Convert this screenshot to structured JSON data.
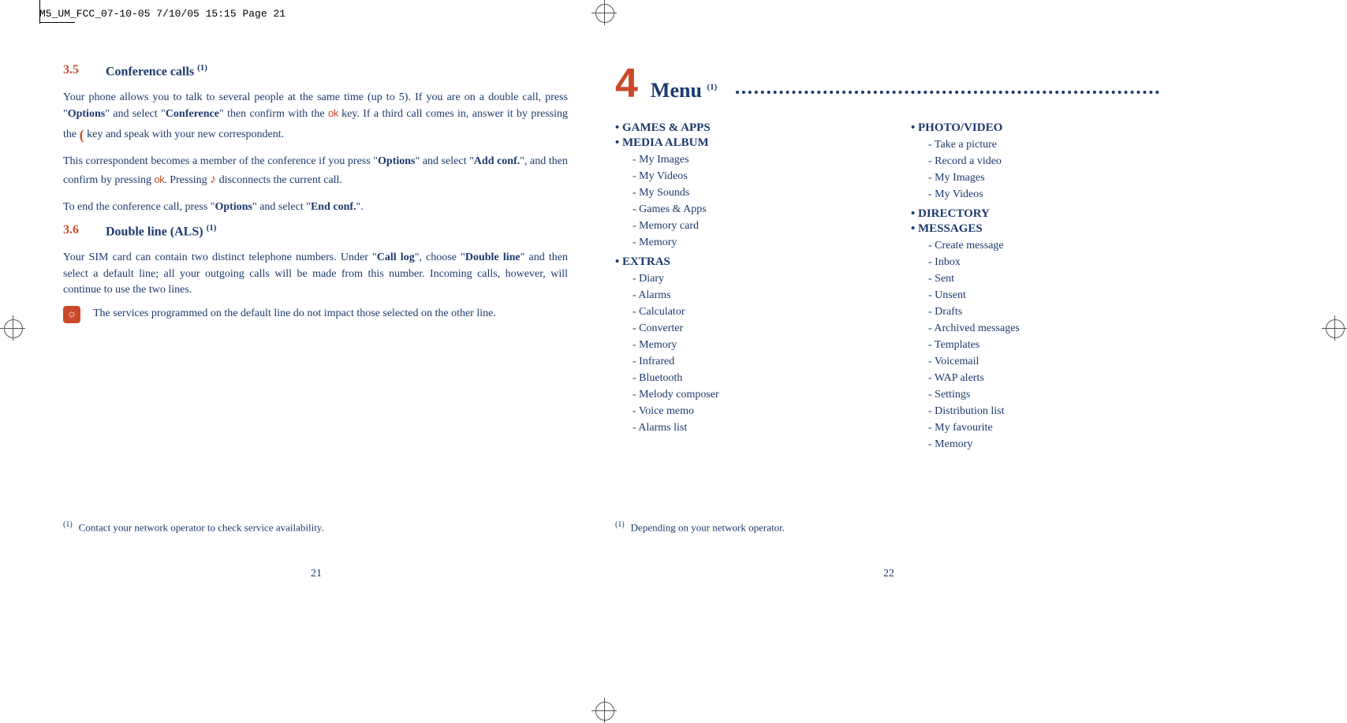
{
  "print_header": "M5_UM_FCC_07-10-05  7/10/05  15:15  Page 21",
  "left": {
    "sec35": {
      "num": "3.5",
      "title": "Conference calls ",
      "sup": "(1)"
    },
    "p35a_pre": "Your phone allows you to talk to several people at the same time (up to 5). If you are on a double call, press \"",
    "p35a_bold1": "Options",
    "p35a_mid1": "\" and select \"",
    "p35a_bold2": "Conference",
    "p35a_mid2": "\" then confirm with the ",
    "ok_label": "ok",
    "p35a_mid3": " key. If a third call comes in, answer it by pressing the ",
    "call_key_glyph": "(",
    "p35a_end": " key and speak with your new correspondent.",
    "p35b_pre": "This correspondent becomes a member of the conference if you press \"",
    "p35b_bold1": "Options",
    "p35b_mid1": "\" and select \"",
    "p35b_bold2": "Add conf.",
    "p35b_mid2": "\", and then confirm by pressing ",
    "p35b_mid3": ". Pressing ",
    "hangup_glyph": "♪",
    "p35b_end": " disconnects the current call.",
    "p35c_pre": "To end the conference call, press \"",
    "p35c_bold1": "Options",
    "p35c_mid1": "\" and select \"",
    "p35c_bold2": "End conf.",
    "p35c_end": "\".",
    "sec36": {
      "num": "3.6",
      "title": "Double line (ALS) ",
      "sup": "(1)"
    },
    "p36a_pre": "Your SIM card can contain two distinct telephone numbers. Under \"",
    "p36a_bold1": "Call log",
    "p36a_mid1": "\", choose \"",
    "p36a_bold2": "Double line",
    "p36a_end": "\" and then select a default line; all your outgoing calls will be made from this number. Incoming calls, however, will continue to use the two lines.",
    "note_icon": "☼",
    "note_text": "The services programmed on the default line do not impact those selected on the other line.",
    "footnote_sup": "(1)",
    "footnote": "Contact your network operator to check service availability.",
    "pagenum": "21"
  },
  "right": {
    "chapter_num": "4",
    "chapter_title": "Menu ",
    "chapter_sup": "(1)",
    "col1": [
      {
        "cat": "GAMES & APPS",
        "items": []
      },
      {
        "cat": "MEDIA ALBUM",
        "items": [
          "My Images",
          "My Videos",
          "My Sounds",
          "Games & Apps",
          "Memory card",
          "Memory"
        ]
      },
      {
        "cat": "EXTRAS",
        "items": [
          "Diary",
          "Alarms",
          "Calculator",
          "Converter",
          "Memory",
          "Infrared",
          "Bluetooth",
          "Melody composer",
          "Voice memo",
          "Alarms list"
        ]
      }
    ],
    "col2": [
      {
        "cat": "PHOTO/VIDEO",
        "items": [
          "Take a picture",
          "Record a video",
          "My Images",
          "My Videos"
        ]
      },
      {
        "cat": "DIRECTORY",
        "items": []
      },
      {
        "cat": "MESSAGES",
        "items": [
          "Create message",
          "Inbox",
          "Sent",
          "Unsent",
          "Drafts",
          "Archived messages",
          "Templates",
          "Voicemail",
          "WAP alerts",
          "Settings",
          "Distribution list",
          "My favourite",
          "Memory"
        ]
      }
    ],
    "footnote_sup": "(1)",
    "footnote": "Depending on your network operator.",
    "pagenum": "22"
  }
}
